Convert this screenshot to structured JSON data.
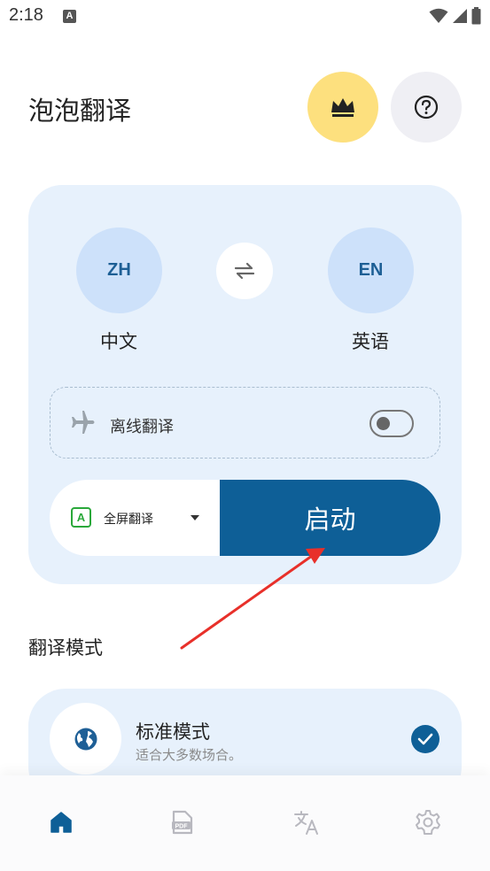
{
  "status_bar": {
    "time": "2:18",
    "notification_icon": "a-badge-icon",
    "right_icons": [
      "wifi-icon",
      "signal-icon",
      "battery-icon"
    ]
  },
  "header": {
    "title": "泡泡翻译",
    "premium_icon": "crown-icon",
    "help_icon": "help-circle-icon"
  },
  "languages": {
    "source_code": "ZH",
    "source_name": "中文",
    "target_code": "EN",
    "target_name": "英语",
    "swap_icon": "swap-arrows-icon"
  },
  "offline": {
    "label": "离线翻译",
    "icon": "airplane-icon",
    "enabled": false
  },
  "translate_mode": {
    "icon_letter": "A",
    "selected": "全屏翻译"
  },
  "start_button": {
    "label": "启动"
  },
  "modes_section": {
    "title": "翻译模式",
    "items": [
      {
        "title": "标准模式",
        "description": "适合大多数场合。",
        "icon": "globe-icon",
        "selected": true
      }
    ]
  },
  "bottom_nav": {
    "items": [
      {
        "icon": "home-icon",
        "active": true
      },
      {
        "icon": "pdf-icon",
        "active": false
      },
      {
        "icon": "translate-icon",
        "active": false
      },
      {
        "icon": "settings-gear-icon",
        "active": false
      }
    ]
  },
  "colors": {
    "accent": "#0e5f97",
    "card_bg": "#e7f1fc",
    "lang_circle": "#cde1fa",
    "premium": "#fde07e",
    "annotation_arrow": "#e8302a"
  }
}
